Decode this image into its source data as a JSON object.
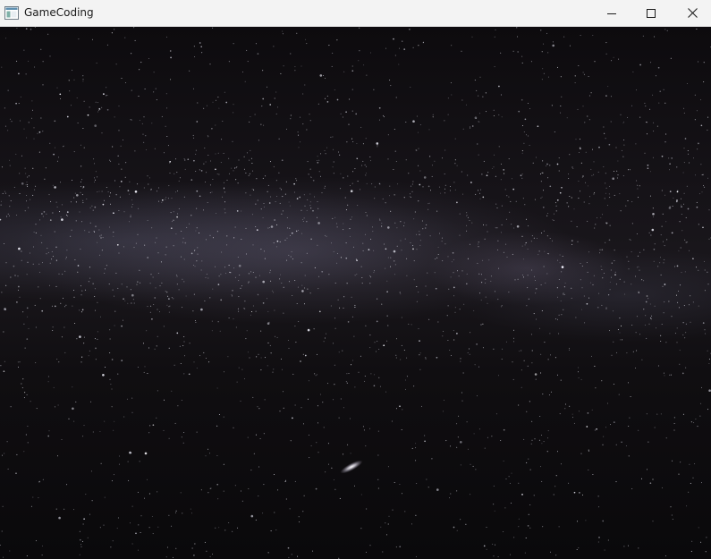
{
  "window": {
    "title": "GameCoding",
    "icon": "app-window-icon",
    "controls": {
      "minimize_icon": "minimize-icon",
      "maximize_icon": "maximize-icon",
      "close_icon": "close-icon"
    }
  },
  "scene": {
    "background": "starfield",
    "colors": {
      "titlebar": "#f3f3f3",
      "sky": "#0c0a0d",
      "milky_way": "#6d6880"
    }
  }
}
